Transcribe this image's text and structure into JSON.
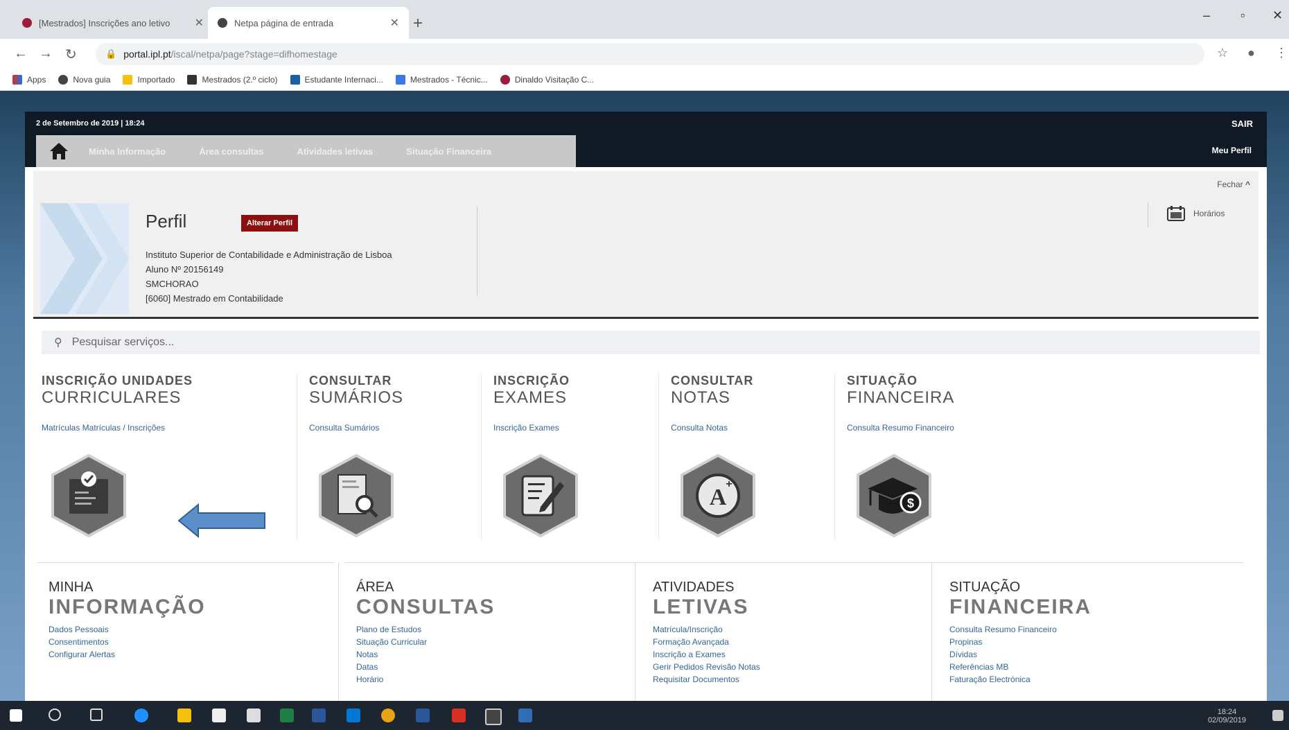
{
  "browser": {
    "tabs": [
      {
        "title": "[Mestrados] Inscrições ano letivo",
        "active": false
      },
      {
        "title": "Netpa página de entrada",
        "active": true
      }
    ],
    "url_domain": "portal.ipl.pt",
    "url_path": "/iscal/netpa/page?stage=difhomestage",
    "bookmarks": [
      "Apps",
      "Nova guia",
      "Importado",
      "Mestrados (2.º ciclo)",
      "Estudante Internaci...",
      "Mestrados - Técnic...",
      "Dinaldo Visitação C..."
    ]
  },
  "portal": {
    "datetime": "2 de Setembro de 2019 | 18:24",
    "logout": "SAIR",
    "nav": [
      "Minha Informação",
      "Área consultas",
      "Atividades letivas",
      "Situação Financeira"
    ],
    "my_profile": "Meu Perfil",
    "close_label": "Fechar",
    "profile": {
      "title": "Perfil",
      "edit_button": "Alterar Perfil",
      "lines": [
        "Instituto Superior de Contabilidade e Administração de Lisboa",
        "Aluno Nº 20156149",
        "SMCHORAO",
        "[6060] Mestrado em Contabilidade"
      ]
    },
    "schedules": "Horários",
    "search_placeholder": "Pesquisar serviços...",
    "services": [
      {
        "line1": "INSCRIÇÃO UNIDADES",
        "line2": "CURRICULARES",
        "link": "Matrículas Matrículas / Inscrições",
        "icon": "enrollment-icon"
      },
      {
        "line1": "CONSULTAR",
        "line2": "SUMÁRIOS",
        "link": "Consulta Sumários",
        "icon": "summaries-icon"
      },
      {
        "line1": "INSCRIÇÃO",
        "line2": "EXAMES",
        "link": "Inscrição Exames",
        "icon": "exam-icon"
      },
      {
        "line1": "CONSULTAR",
        "line2": "NOTAS",
        "link": "Consulta Notas",
        "icon": "grades-icon"
      },
      {
        "line1": "SITUAÇÃO",
        "line2": "FINANCEIRA",
        "link": "Consulta Resumo Financeiro",
        "icon": "finance-icon"
      }
    ],
    "sections": [
      {
        "line1": "MINHA",
        "line2": "INFORMAÇÃO",
        "links": [
          "Dados Pessoais",
          "Consentimentos",
          "Configurar Alertas"
        ]
      },
      {
        "line1": "ÁREA",
        "line2": "CONSULTAS",
        "links": [
          "Plano de Estudos",
          "Situação Curricular",
          "Notas",
          "Datas",
          "Horário"
        ]
      },
      {
        "line1": "ATIVIDADES",
        "line2": "LETIVAS",
        "links": [
          "Matrícula/Inscrição",
          "Formação Avançada",
          "Inscrição a Exames",
          "Gerir Pedidos Revisão Notas",
          "Requisitar Documentos"
        ]
      },
      {
        "line1": "SITUAÇÃO",
        "line2": "FINANCEIRA",
        "links": [
          "Consulta Resumo Financeiro",
          "Propinas",
          "Dívidas",
          "Referências MB",
          "Faturação Electrónica"
        ]
      }
    ]
  },
  "taskbar": {
    "time": "18:24",
    "date": "02/09/2019"
  },
  "colors": {
    "accent_red": "#8c1010",
    "nav_dark": "#0f1a24",
    "link_blue": "#336699",
    "hex_gray": "#6b6b6b"
  }
}
